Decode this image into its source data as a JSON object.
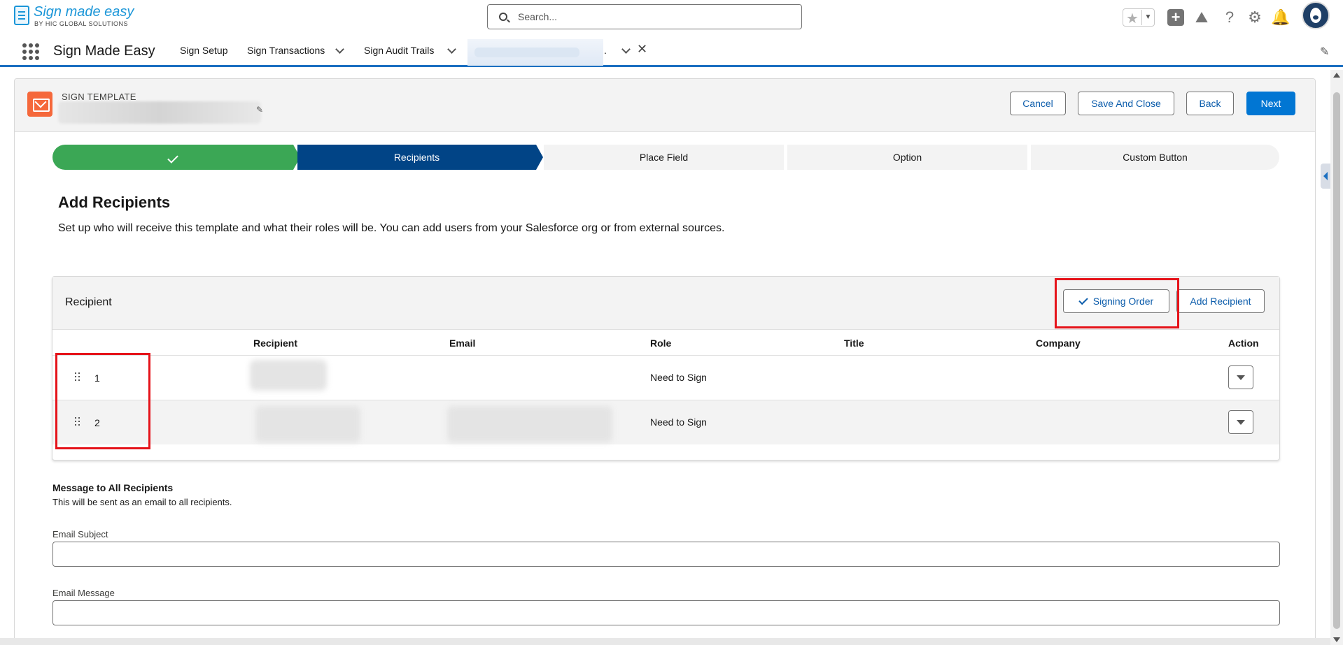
{
  "header": {
    "logo_text": "Sign made easy",
    "logo_subtitle": "BY HIC GLOBAL SOLUTIONS",
    "search_placeholder": "Search...",
    "icons": [
      "favorites-star-icon",
      "add-icon",
      "trailhead-icon",
      "help-icon",
      "setup-gear-icon",
      "notifications-bell-icon",
      "avatar"
    ]
  },
  "nav": {
    "app_name": "Sign Made Easy",
    "items": [
      {
        "label": "Sign Setup",
        "has_menu": false
      },
      {
        "label": "Sign Transactions",
        "has_menu": true
      },
      {
        "label": "Sign Audit Trails",
        "has_menu": true
      }
    ],
    "active_tab_label": "."
  },
  "record": {
    "type_label": "SIGN TEMPLATE",
    "buttons": {
      "cancel": "Cancel",
      "save_close": "Save And Close",
      "back": "Back",
      "next": "Next"
    }
  },
  "path": {
    "stages": [
      {
        "label": "",
        "status": "complete"
      },
      {
        "label": "Recipients",
        "status": "current"
      },
      {
        "label": "Place Field",
        "status": "incomplete"
      },
      {
        "label": "Option",
        "status": "incomplete"
      },
      {
        "label": "Custom Button",
        "status": "incomplete"
      }
    ]
  },
  "section": {
    "title": "Add Recipients",
    "description": "Set up who will receive this template and what their roles will be. You can add users from your Salesforce org or from external sources."
  },
  "recipients_card": {
    "title": "Recipient",
    "signing_order_label": "Signing Order",
    "add_recipient_label": "Add Recipient",
    "columns": [
      "Recipient",
      "Email",
      "Role",
      "Title",
      "Company",
      "Action"
    ],
    "rows": [
      {
        "order": "1",
        "role": "Need to Sign"
      },
      {
        "order": "2",
        "role": "Need to Sign"
      }
    ]
  },
  "message": {
    "title": "Message to All Recipients",
    "description": "This will be sent as an email to all recipients.",
    "subject_label": "Email Subject",
    "subject_value": "",
    "body_label": "Email Message",
    "body_value": ""
  },
  "colors": {
    "brand": "#0176d3",
    "path_complete": "#3ba755",
    "path_current": "#014486",
    "highlight": "#e5131a",
    "record_icon": "#f5683b"
  }
}
